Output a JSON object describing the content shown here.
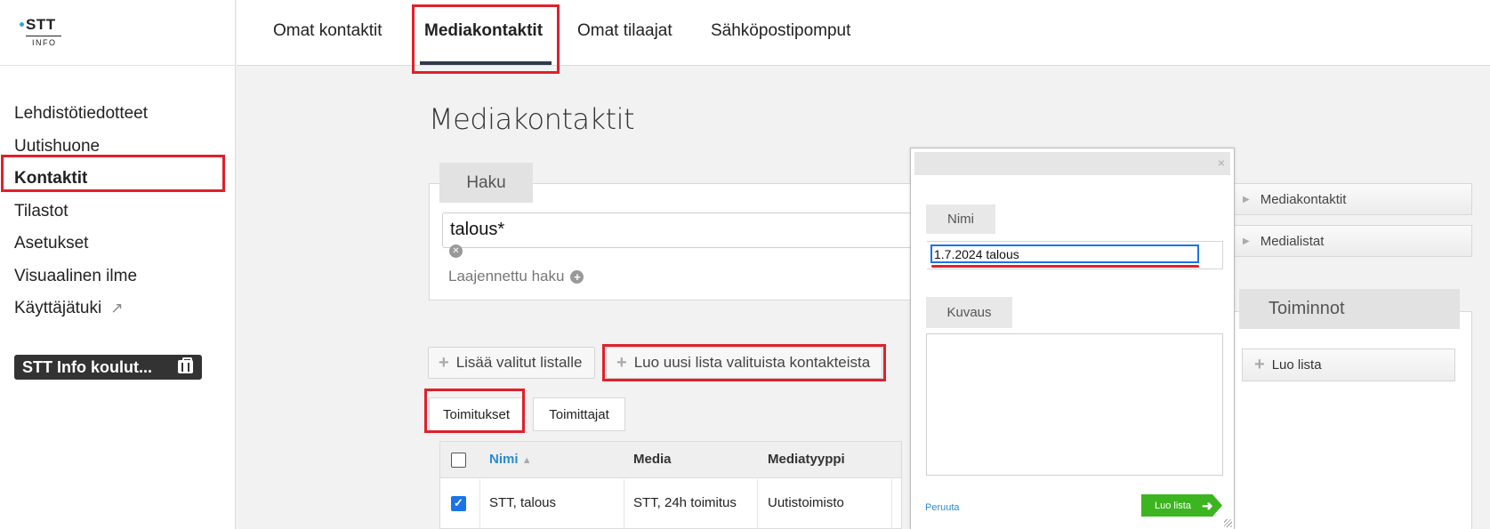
{
  "sidebar": {
    "logo": {
      "name": "STT",
      "sub": "INFO"
    },
    "items": [
      {
        "label": "Lehdistötiedotteet"
      },
      {
        "label": "Uutishuone"
      },
      {
        "label": "Kontaktit"
      },
      {
        "label": "Tilastot"
      },
      {
        "label": "Asetukset"
      },
      {
        "label": "Visuaalinen ilme"
      },
      {
        "label": "Käyttäjätuki",
        "icon": "external-link-icon"
      }
    ],
    "badge": {
      "label": "STT Info koulut...",
      "icon": "briefcase-icon"
    }
  },
  "topnav": {
    "tabs": [
      {
        "label": "Omat kontaktit"
      },
      {
        "label": "Mediakontaktit"
      },
      {
        "label": "Omat tilaajat"
      },
      {
        "label": "Sähköpostipomput"
      }
    ]
  },
  "main": {
    "title": "Mediakontaktit",
    "search": {
      "tab_label": "Haku",
      "value": "talous*",
      "advanced_label": "Laajennettu haku"
    },
    "actions": {
      "add_selected": "Lisää valitut listalle",
      "create_list": "Luo uusi lista valituista kontakteista"
    },
    "subtabs": [
      {
        "label": "Toimitukset"
      },
      {
        "label": "Toimittajat"
      }
    ],
    "table": {
      "headers": [
        "Nimi",
        "Media",
        "Mediatyyppi"
      ],
      "rows": [
        {
          "checked": true,
          "nimi": "STT, talous",
          "media": "STT, 24h toimitus",
          "mediatyyppi": "Uutistoimisto"
        }
      ]
    }
  },
  "right": {
    "accordions": [
      {
        "label": "Mediakontaktit"
      },
      {
        "label": "Medialistat"
      }
    ],
    "toiminnot": {
      "title": "Toiminnot",
      "button": "Luo lista"
    }
  },
  "modal": {
    "close": "×",
    "name_label": "Nimi",
    "name_value": "1.7.2024 talous",
    "desc_label": "Kuvaus",
    "desc_value": "",
    "cancel": "Peruuta",
    "submit": "Luo lista"
  },
  "colors": {
    "highlight": "#e0202a",
    "link": "#2a8bd0",
    "submit": "#3cb521",
    "focus": "#1a73e8"
  }
}
